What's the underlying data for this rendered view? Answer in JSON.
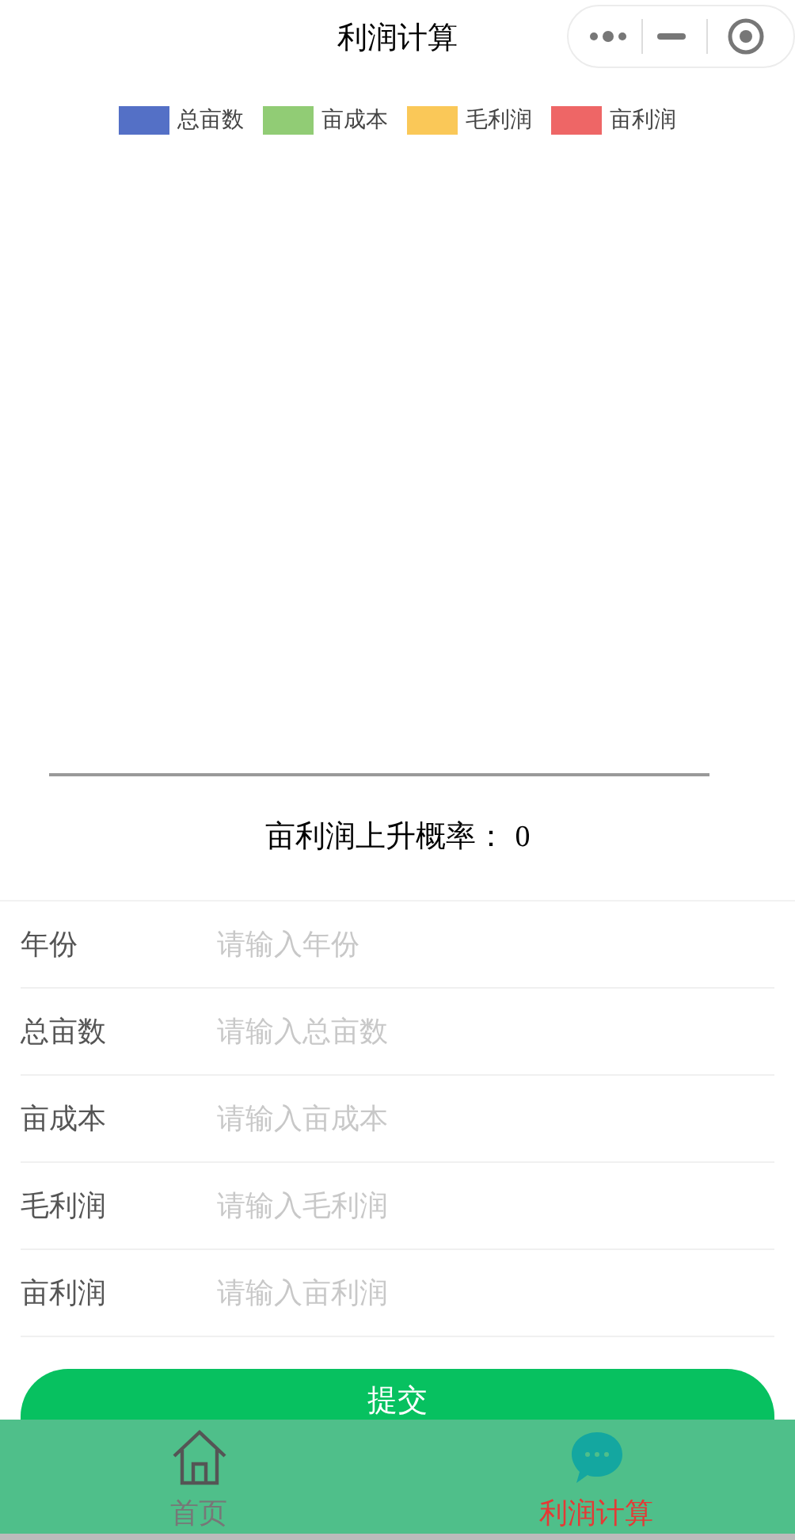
{
  "window": {
    "title": "利润计算"
  },
  "chart": {
    "legend": [
      {
        "label": "总亩数",
        "color": "#5470c6"
      },
      {
        "label": "亩成本",
        "color": "#91cc75"
      },
      {
        "label": "毛利润",
        "color": "#fac858"
      },
      {
        "label": "亩利润",
        "color": "#ee6666"
      }
    ]
  },
  "probability": {
    "label": "亩利润上升概率：",
    "value": "0"
  },
  "form": {
    "fields": [
      {
        "label": "年份",
        "placeholder": "请输入年份"
      },
      {
        "label": "总亩数",
        "placeholder": "请输入总亩数"
      },
      {
        "label": "亩成本",
        "placeholder": "请输入亩成本"
      },
      {
        "label": "毛利润",
        "placeholder": "请输入毛利润"
      },
      {
        "label": "亩利润",
        "placeholder": "请输入亩利润"
      }
    ],
    "submit": "提交"
  },
  "tab_bar": [
    {
      "kind": "home",
      "label": "首页",
      "selected": false
    },
    {
      "kind": "chat",
      "label": "利润计算",
      "selected": true
    }
  ]
}
